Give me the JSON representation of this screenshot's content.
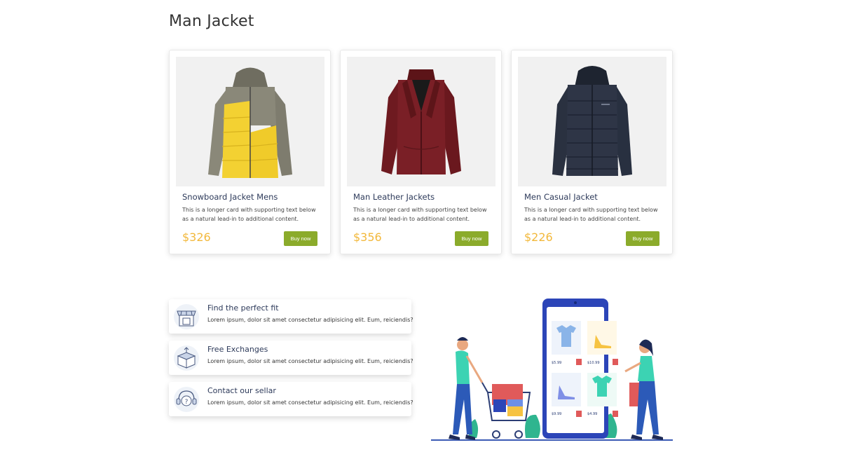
{
  "page": {
    "title": "Man Jacket"
  },
  "products": [
    {
      "name": "Snowboard Jacket Mens",
      "description": "This is a longer card with supporting text below as a natural lead-in to additional content.",
      "price": "$326",
      "button": "Buy now",
      "image_icon": "yellow-grey-puffer-jacket"
    },
    {
      "name": "Man Leather Jackets",
      "description": "This is a longer card with supporting text below as a natural lead-in to additional content.",
      "price": "$356",
      "button": "Buy now",
      "image_icon": "maroon-leather-jacket"
    },
    {
      "name": "Men Casual Jacket",
      "description": "This is a longer card with supporting text below as a natural lead-in to additional content.",
      "price": "$226",
      "button": "Buy now",
      "image_icon": "navy-quilted-jacket"
    }
  ],
  "features": [
    {
      "title": "Find the perfect fit",
      "text": "Lorem ipsum, dolor sit amet consectetur adipisicing elit. Eum, reiciendis?",
      "icon": "store-icon"
    },
    {
      "title": "Free Exchanges",
      "text": "Lorem ipsum, dolor sit amet consectetur adipisicing elit. Eum, reiciendis?",
      "icon": "box-icon"
    },
    {
      "title": "Contact our sellar",
      "text": "Lorem ipsum, dolor sit amet consectetur adipisicing elit. Eum, reiciendis?",
      "icon": "support-icon"
    }
  ],
  "illustration": {
    "prices": [
      "$5.99",
      "$10.99",
      "$9.99",
      "$4.99"
    ]
  },
  "colors": {
    "price": "#f2b83b",
    "button": "#8bab2b",
    "title": "#2d3a5a"
  }
}
